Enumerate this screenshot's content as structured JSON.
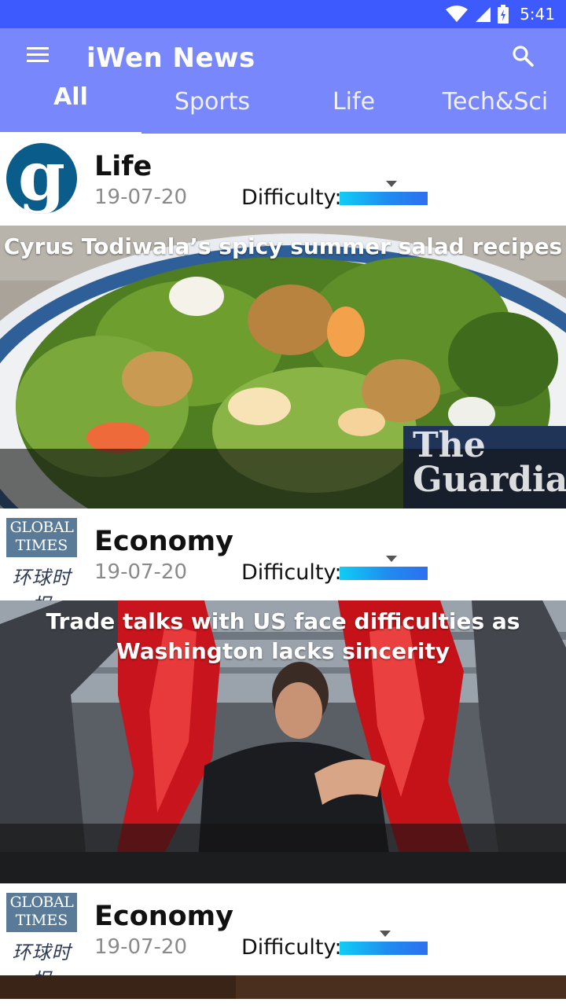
{
  "status_bar": {
    "time": "5:41"
  },
  "app_bar": {
    "title": "iWen News"
  },
  "tabs": [
    {
      "label": "All",
      "active": true
    },
    {
      "label": "Sports",
      "active": false
    },
    {
      "label": "Life",
      "active": false
    },
    {
      "label": "Tech&Sci",
      "active": false
    }
  ],
  "articles": [
    {
      "source_logo": "the-guardian",
      "category": "Life",
      "date": "19-07-20",
      "difficulty_label": "Difficulty:",
      "difficulty_level": 0.59,
      "title": "Cyrus Todiwala’s spicy summer salad recipes",
      "image_watermark": "The Guardian"
    },
    {
      "source_logo": "global-times",
      "category": "Economy",
      "date": "19-07-20",
      "difficulty_label": "Difficulty:",
      "difficulty_level": 0.59,
      "title": "Trade talks with US face difficulties as Washington lacks sincerity"
    },
    {
      "source_logo": "global-times",
      "category": "Economy",
      "date": "19-07-20",
      "difficulty_label": "Difficulty:",
      "difficulty_level": 0.52
    }
  ],
  "logos": {
    "guardian_letter": "g",
    "global_times_line1": "GLOBAL",
    "global_times_line2": "TIMES",
    "global_times_cn": "环球时报"
  },
  "colors": {
    "status_bar": "#3d5afe",
    "app_bar": "#7888fc",
    "difficulty_start": "#10cdf5",
    "difficulty_end": "#2e6ff0"
  }
}
